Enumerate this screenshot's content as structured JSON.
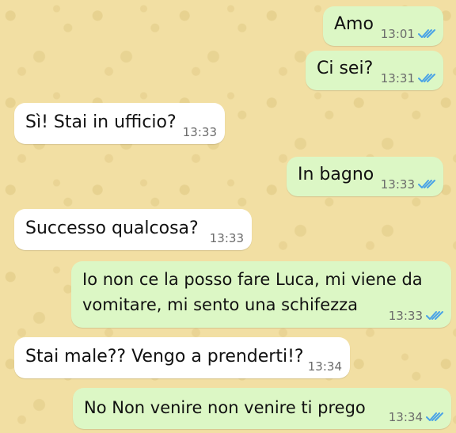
{
  "chat": {
    "tick_color": "#4aa3e6",
    "sent_bubble_color": "#dcf7c5",
    "received_bubble_color": "#ffffff",
    "background_color": "#f2dfa3",
    "messages": [
      {
        "direction": "sent",
        "text": "Amo",
        "time": "13:01",
        "status": "read"
      },
      {
        "direction": "sent",
        "text": "Ci sei?",
        "time": "13:31",
        "status": "read"
      },
      {
        "direction": "received",
        "text": "Sì! Stai in ufficio?",
        "time": "13:33"
      },
      {
        "direction": "sent",
        "text": "In bagno",
        "time": "13:33",
        "status": "read"
      },
      {
        "direction": "received",
        "text": "Successo qualcosa?",
        "time": "13:33"
      },
      {
        "direction": "sent",
        "text_line1": "Io non ce la posso fare Luca, mi viene da",
        "text_line2": "vomitare, mi sento una schifezza",
        "time": "13:33",
        "status": "read"
      },
      {
        "direction": "received",
        "text": "Stai male?? Vengo a prenderti!?",
        "time": "13:34"
      },
      {
        "direction": "sent",
        "text": "No Non venire non venire ti prego",
        "time": "13:34",
        "status": "read"
      }
    ]
  }
}
